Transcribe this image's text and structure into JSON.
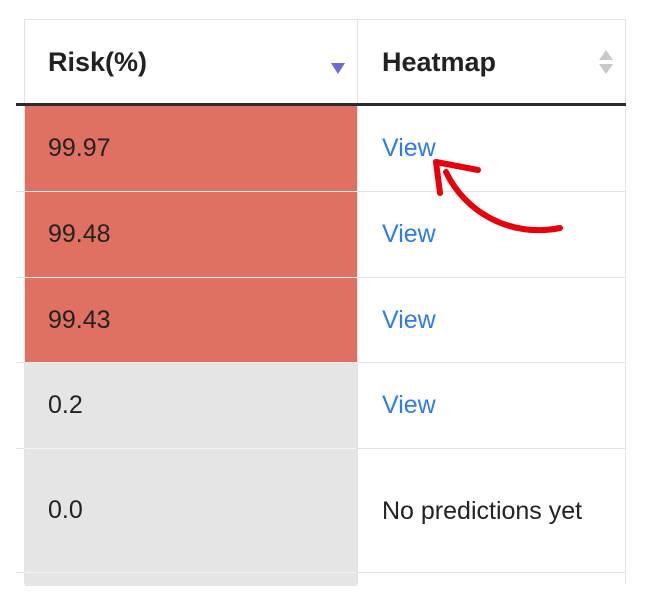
{
  "table": {
    "headers": {
      "risk": "Risk(%)",
      "heatmap": "Heatmap"
    },
    "rows": [
      {
        "risk": "99.97",
        "heatmap": "View",
        "level": "high"
      },
      {
        "risk": "99.48",
        "heatmap": "View",
        "level": "high"
      },
      {
        "risk": "99.43",
        "heatmap": "View",
        "level": "high"
      },
      {
        "risk": "0.2",
        "heatmap": "View",
        "level": "low"
      },
      {
        "risk": "0.0",
        "heatmap": "No predictions yet",
        "level": "low"
      }
    ],
    "sort": {
      "column": "risk",
      "direction": "descending"
    }
  },
  "colors": {
    "high_risk": "#e07062",
    "low_risk": "#e5e5e5",
    "link": "#2f7be8",
    "annotation_arrow": "#e8000b"
  },
  "icons": {
    "risk_sort": "sort-descending-icon",
    "heatmap_sort": "sort-both-icon",
    "annotation": "curved-arrow-icon"
  }
}
